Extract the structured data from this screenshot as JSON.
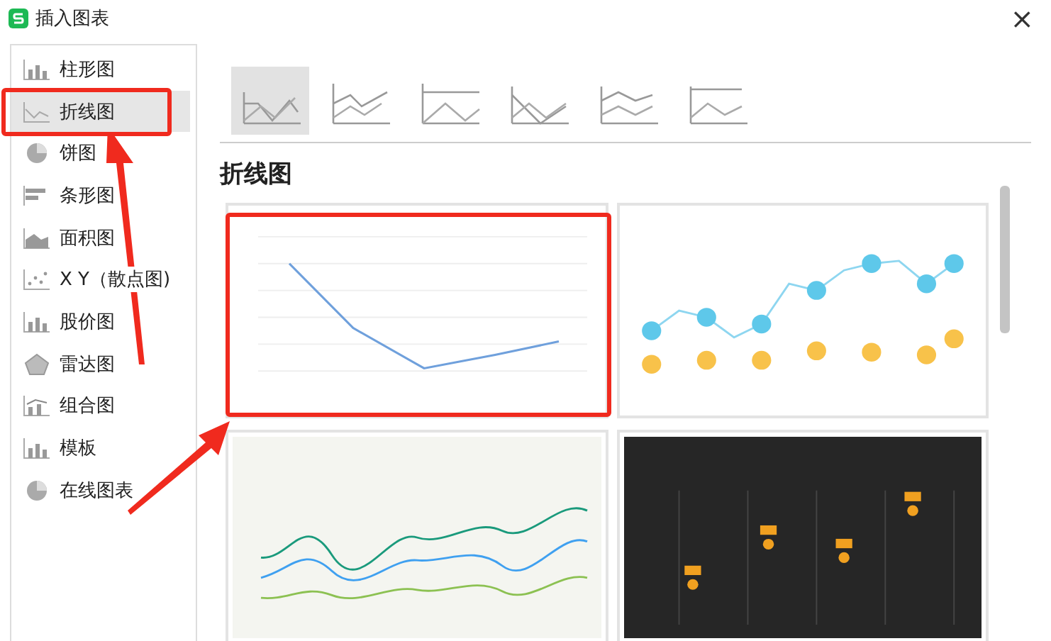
{
  "window": {
    "title": "插入图表",
    "close": "×"
  },
  "sidebar": {
    "items": [
      {
        "label": "柱形图",
        "selected": false,
        "marked": false
      },
      {
        "label": "折线图",
        "selected": true,
        "marked": true
      },
      {
        "label": "饼图",
        "selected": false,
        "marked": false
      },
      {
        "label": "条形图",
        "selected": false,
        "marked": false
      },
      {
        "label": "面积图",
        "selected": false,
        "marked": false
      },
      {
        "label": "X Y（散点图)",
        "selected": false,
        "marked": false
      },
      {
        "label": "股价图",
        "selected": false,
        "marked": false
      },
      {
        "label": "雷达图",
        "selected": false,
        "marked": false
      },
      {
        "label": "组合图",
        "selected": false,
        "marked": false
      },
      {
        "label": "模板",
        "selected": false,
        "marked": false
      },
      {
        "label": "在线图表",
        "selected": false,
        "marked": false
      }
    ]
  },
  "subtypes": [
    {
      "selected": true
    },
    {
      "selected": false
    },
    {
      "selected": false
    },
    {
      "selected": false
    },
    {
      "selected": false
    },
    {
      "selected": false
    }
  ],
  "section_title": "折线图",
  "templates": [
    {
      "kind": "picture",
      "marked": true
    },
    {
      "kind": "picture",
      "marked": false
    },
    {
      "kind": "picture",
      "marked": false
    },
    {
      "kind": "picture",
      "marked": false
    }
  ]
}
